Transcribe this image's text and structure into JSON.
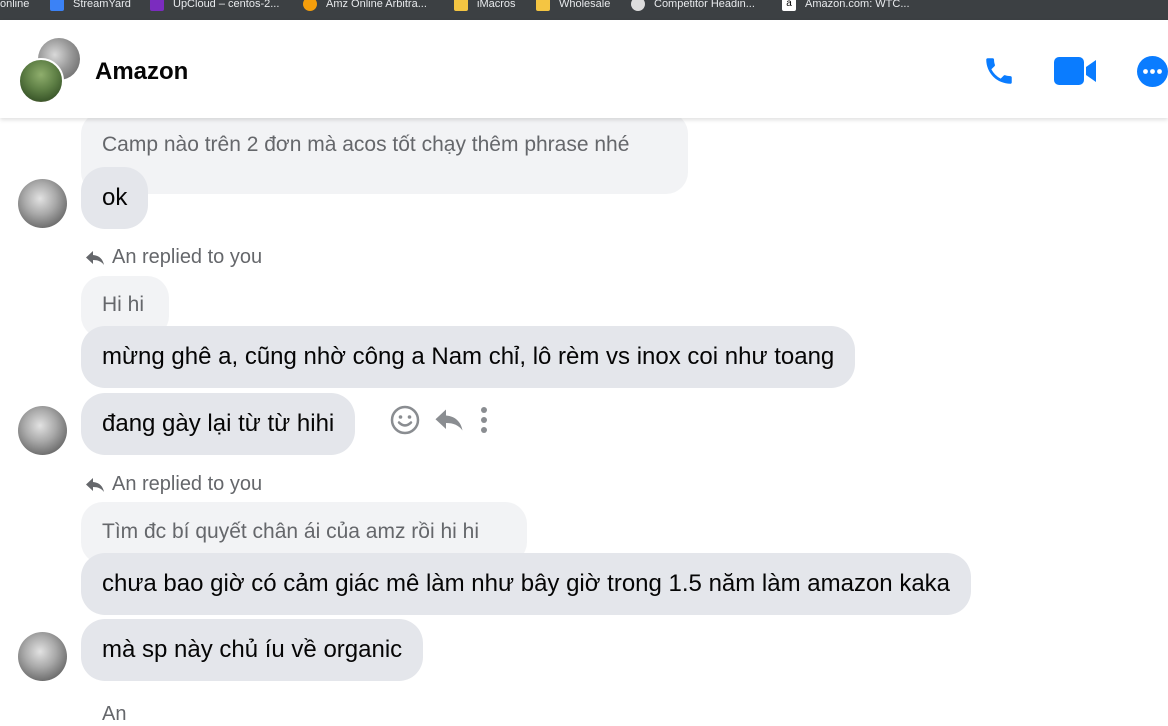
{
  "bookmarks": [
    {
      "label": "online",
      "icon": "none"
    },
    {
      "label": "StreamYard",
      "icon": "streamyard-icon",
      "color": "#3b82f6"
    },
    {
      "label": "UpCloud – centos-2...",
      "icon": "upcloud-icon",
      "color": "#7b2cbf"
    },
    {
      "label": "Amz Online Arbitra...",
      "icon": "amz-arbitrage-icon",
      "color": "#f59e0b"
    },
    {
      "label": "iMacros",
      "icon": "folder-icon",
      "color": "#f4c542"
    },
    {
      "label": "Wholesale",
      "icon": "folder-icon",
      "color": "#f4c542"
    },
    {
      "label": "Competitor Headin...",
      "icon": "chrome-icon",
      "color": "#dddddd"
    },
    {
      "label": "Amazon.com: WTC...",
      "icon": "amazon-icon",
      "color": "#ffffff"
    }
  ],
  "header": {
    "title": "Amazon",
    "accent_color": "#0a7cff"
  },
  "messages": {
    "m1_quoted": "Camp nào trên 2 đơn mà acos tốt chạy thêm phrase nhé",
    "m1_reply": "ok",
    "m2_replied_label": "An replied to you",
    "m2_quoted": "Hi hi",
    "m2_reply_a": "mừng ghê a, cũng nhờ công a Nam chỉ, lô rèm vs inox coi như toang",
    "m2_reply_b": "đang gày lại từ từ hihi",
    "m3_replied_label": "An replied to you",
    "m3_quoted": "Tìm đc bí quyết chân ái của amz rồi hi hi",
    "m3_reply_a": "chưa bao giờ có cảm giác mê làm như bây giờ trong 1.5 năm làm amazon kaka",
    "m3_reply_b": "mà sp này chủ íu về organic",
    "m4_partial": "An"
  }
}
